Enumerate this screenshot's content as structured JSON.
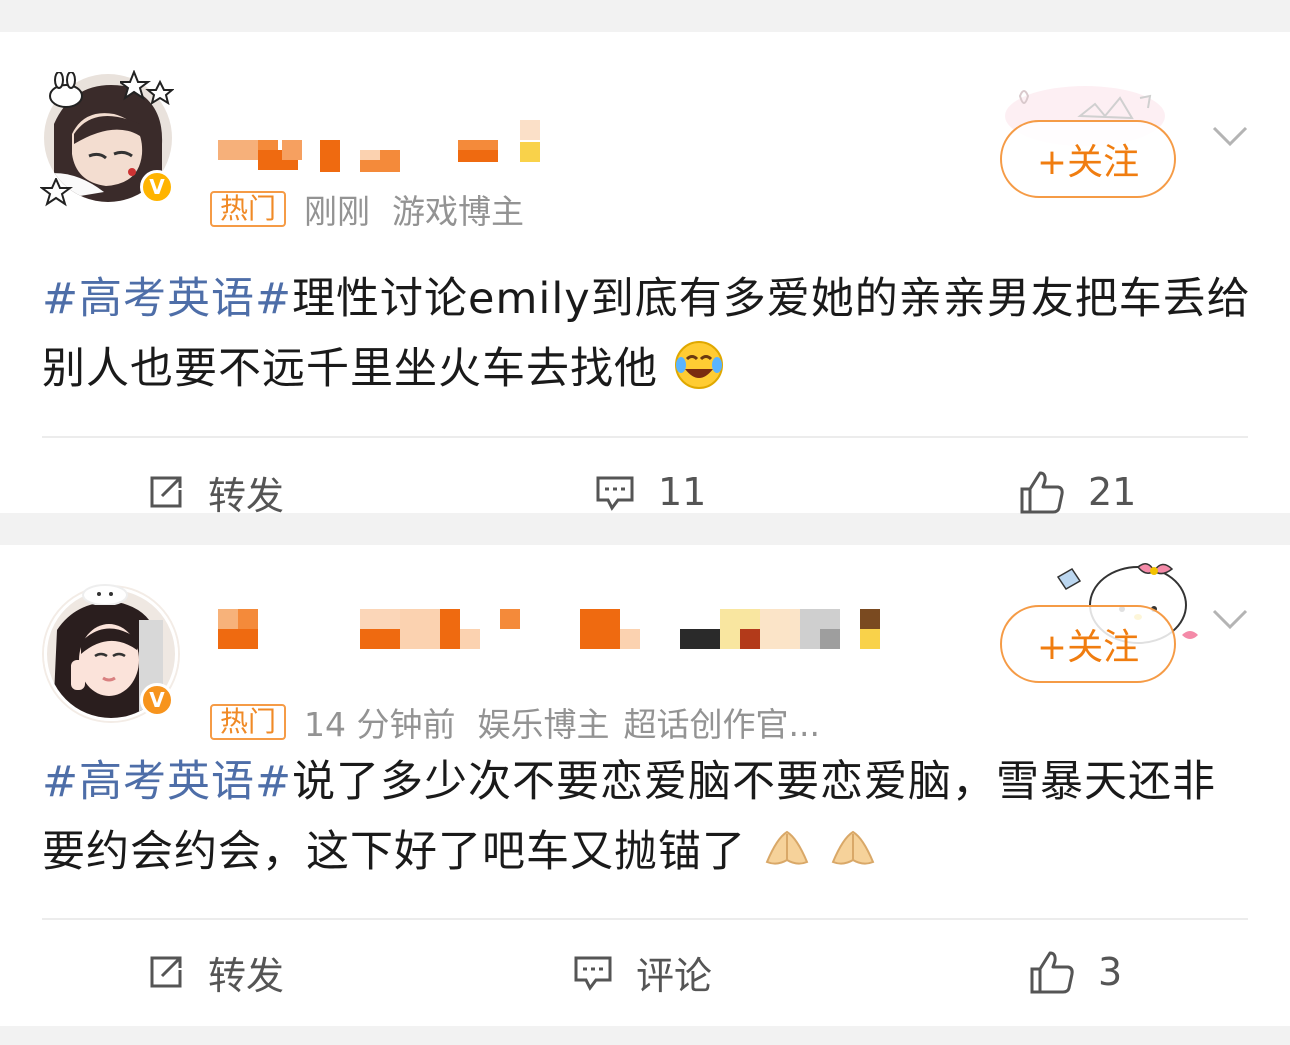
{
  "posts": [
    {
      "hot_tag": "热门",
      "time": "刚刚",
      "role": "游戏博主",
      "follow_label": "+关注",
      "topic": "#高考英语#",
      "text": "理性讨论emily到底有多爱她的亲亲男友把车丢给别人也要不远千里坐火车去找他",
      "actions": {
        "repost": "转发",
        "comment": "11",
        "like": "21"
      }
    },
    {
      "hot_tag": "热门",
      "time": "14 分钟前",
      "role": "娱乐博主",
      "extra": "超话创作官...",
      "follow_label": "+关注",
      "topic": "#高考英语#",
      "text": "说了多少次不要恋爱脑不要恋爱脑，雪暴天还非要约会约会，这下好了吧车又抛锚了",
      "actions": {
        "repost": "转发",
        "comment": "评论",
        "like": "3"
      }
    }
  ],
  "colors": {
    "accent": "#f07d10",
    "topic": "#4e6ea8",
    "badge": "#ffb400",
    "background": "#f2f2f2"
  },
  "icons": [
    "repost-icon",
    "comment-icon",
    "like-icon",
    "chevron-down-icon",
    "verified-badge-icon"
  ]
}
